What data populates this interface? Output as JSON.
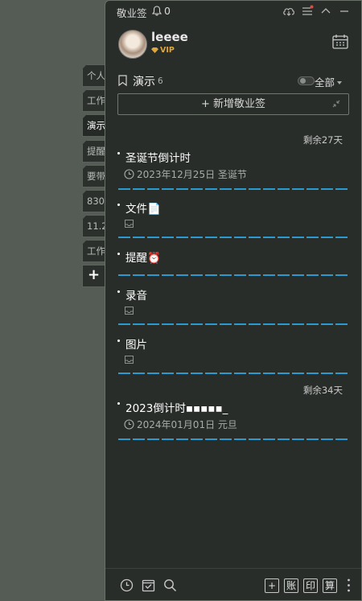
{
  "side_tabs": [
    "个人",
    "工作",
    "演示",
    "提醒",
    "要带",
    "830",
    "11.2",
    "工作"
  ],
  "side_add_label": "+",
  "app": {
    "title": "敬业签",
    "notification_count": "0"
  },
  "user": {
    "name": "leeee",
    "badge": "VIP"
  },
  "group": {
    "name": "演示",
    "count": "6",
    "filter": "全部"
  },
  "add_button_label": "+ 新增敬业签",
  "notes": [
    {
      "title": "圣诞节倒计时",
      "remaining": "剩余27天",
      "date": "2023年12月25日 圣诞节"
    },
    {
      "title": "文件📄"
    },
    {
      "title": "提醒⏰"
    },
    {
      "title": "录音"
    },
    {
      "title": "图片"
    },
    {
      "title": "2023倒计时▪▪▪▪▪_",
      "remaining": "剩余34天",
      "date": "2024年01月01日 元旦"
    }
  ],
  "bottom_buttons": [
    "+",
    "账",
    "印",
    "算"
  ],
  "colors": {
    "accent": "#2a9bd0",
    "vip": "#e0a83b",
    "panel": "#292d2a",
    "desktop": "#555c55"
  }
}
